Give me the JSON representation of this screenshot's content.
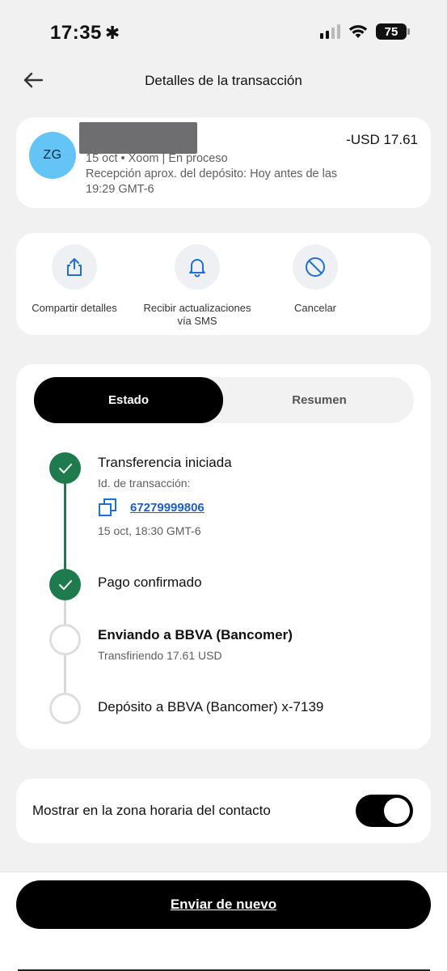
{
  "status_bar": {
    "time": "17:35",
    "time_glyph": "✱",
    "battery": "75"
  },
  "header": {
    "title": "Detalles de la transacción",
    "back_icon": "arrow-left-icon"
  },
  "transaction": {
    "avatar_initials": "ZG",
    "amount": "-USD 17.61",
    "meta": "15 oct • Xoom | En proceso",
    "eta": "Recepción aprox. del depósito: Hoy antes de las 19:29 GMT-6",
    "avatar_color": "#63c4f5"
  },
  "actions": [
    {
      "label": "Compartir detalles",
      "icon": "share-icon"
    },
    {
      "label": "Recibir actualizaciones vía SMS",
      "icon": "bell-icon"
    },
    {
      "label": "Cancelar",
      "icon": "cancel-icon"
    }
  ],
  "tabs": {
    "active": "Estado",
    "inactive": "Resumen"
  },
  "timeline": {
    "steps": [
      {
        "title": "Transferencia iniciada",
        "status": "done"
      },
      {
        "title": "Pago confirmado",
        "status": "done"
      },
      {
        "title": "Enviando a BBVA (Bancomer)",
        "status": "current",
        "subtitle": "Transfiriendo 17.61 USD"
      },
      {
        "title": "Depósito a BBVA (Bancomer) x-7139",
        "status": "pending"
      }
    ],
    "tx_id_label": "Id. de transacción:",
    "tx_id": "67279999806",
    "initiated_time": "15 oct, 18:30 GMT-6"
  },
  "toggle": {
    "label": "Mostrar en la zona horaria del contacto",
    "on": true
  },
  "footer": {
    "resend_label": "Enviar de nuevo"
  },
  "colors": {
    "accent_green": "#1f7a4e",
    "link_blue": "#1a5fc9",
    "icon_blue": "#1e6fd9"
  }
}
